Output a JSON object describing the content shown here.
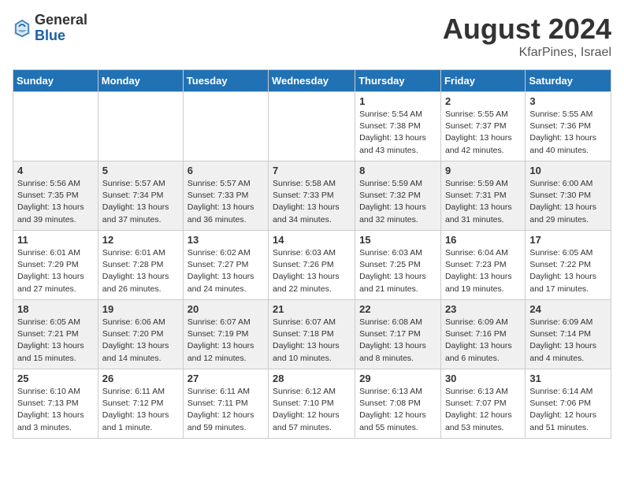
{
  "logo": {
    "general": "General",
    "blue": "Blue"
  },
  "header": {
    "month_year": "August 2024",
    "location": "KfarPines, Israel"
  },
  "days_of_week": [
    "Sunday",
    "Monday",
    "Tuesday",
    "Wednesday",
    "Thursday",
    "Friday",
    "Saturday"
  ],
  "weeks": [
    [
      {
        "day": "",
        "detail": ""
      },
      {
        "day": "",
        "detail": ""
      },
      {
        "day": "",
        "detail": ""
      },
      {
        "day": "",
        "detail": ""
      },
      {
        "day": "1",
        "detail": "Sunrise: 5:54 AM\nSunset: 7:38 PM\nDaylight: 13 hours\nand 43 minutes."
      },
      {
        "day": "2",
        "detail": "Sunrise: 5:55 AM\nSunset: 7:37 PM\nDaylight: 13 hours\nand 42 minutes."
      },
      {
        "day": "3",
        "detail": "Sunrise: 5:55 AM\nSunset: 7:36 PM\nDaylight: 13 hours\nand 40 minutes."
      }
    ],
    [
      {
        "day": "4",
        "detail": "Sunrise: 5:56 AM\nSunset: 7:35 PM\nDaylight: 13 hours\nand 39 minutes."
      },
      {
        "day": "5",
        "detail": "Sunrise: 5:57 AM\nSunset: 7:34 PM\nDaylight: 13 hours\nand 37 minutes."
      },
      {
        "day": "6",
        "detail": "Sunrise: 5:57 AM\nSunset: 7:33 PM\nDaylight: 13 hours\nand 36 minutes."
      },
      {
        "day": "7",
        "detail": "Sunrise: 5:58 AM\nSunset: 7:33 PM\nDaylight: 13 hours\nand 34 minutes."
      },
      {
        "day": "8",
        "detail": "Sunrise: 5:59 AM\nSunset: 7:32 PM\nDaylight: 13 hours\nand 32 minutes."
      },
      {
        "day": "9",
        "detail": "Sunrise: 5:59 AM\nSunset: 7:31 PM\nDaylight: 13 hours\nand 31 minutes."
      },
      {
        "day": "10",
        "detail": "Sunrise: 6:00 AM\nSunset: 7:30 PM\nDaylight: 13 hours\nand 29 minutes."
      }
    ],
    [
      {
        "day": "11",
        "detail": "Sunrise: 6:01 AM\nSunset: 7:29 PM\nDaylight: 13 hours\nand 27 minutes."
      },
      {
        "day": "12",
        "detail": "Sunrise: 6:01 AM\nSunset: 7:28 PM\nDaylight: 13 hours\nand 26 minutes."
      },
      {
        "day": "13",
        "detail": "Sunrise: 6:02 AM\nSunset: 7:27 PM\nDaylight: 13 hours\nand 24 minutes."
      },
      {
        "day": "14",
        "detail": "Sunrise: 6:03 AM\nSunset: 7:26 PM\nDaylight: 13 hours\nand 22 minutes."
      },
      {
        "day": "15",
        "detail": "Sunrise: 6:03 AM\nSunset: 7:25 PM\nDaylight: 13 hours\nand 21 minutes."
      },
      {
        "day": "16",
        "detail": "Sunrise: 6:04 AM\nSunset: 7:23 PM\nDaylight: 13 hours\nand 19 minutes."
      },
      {
        "day": "17",
        "detail": "Sunrise: 6:05 AM\nSunset: 7:22 PM\nDaylight: 13 hours\nand 17 minutes."
      }
    ],
    [
      {
        "day": "18",
        "detail": "Sunrise: 6:05 AM\nSunset: 7:21 PM\nDaylight: 13 hours\nand 15 minutes."
      },
      {
        "day": "19",
        "detail": "Sunrise: 6:06 AM\nSunset: 7:20 PM\nDaylight: 13 hours\nand 14 minutes."
      },
      {
        "day": "20",
        "detail": "Sunrise: 6:07 AM\nSunset: 7:19 PM\nDaylight: 13 hours\nand 12 minutes."
      },
      {
        "day": "21",
        "detail": "Sunrise: 6:07 AM\nSunset: 7:18 PM\nDaylight: 13 hours\nand 10 minutes."
      },
      {
        "day": "22",
        "detail": "Sunrise: 6:08 AM\nSunset: 7:17 PM\nDaylight: 13 hours\nand 8 minutes."
      },
      {
        "day": "23",
        "detail": "Sunrise: 6:09 AM\nSunset: 7:16 PM\nDaylight: 13 hours\nand 6 minutes."
      },
      {
        "day": "24",
        "detail": "Sunrise: 6:09 AM\nSunset: 7:14 PM\nDaylight: 13 hours\nand 4 minutes."
      }
    ],
    [
      {
        "day": "25",
        "detail": "Sunrise: 6:10 AM\nSunset: 7:13 PM\nDaylight: 13 hours\nand 3 minutes."
      },
      {
        "day": "26",
        "detail": "Sunrise: 6:11 AM\nSunset: 7:12 PM\nDaylight: 13 hours\nand 1 minute."
      },
      {
        "day": "27",
        "detail": "Sunrise: 6:11 AM\nSunset: 7:11 PM\nDaylight: 12 hours\nand 59 minutes."
      },
      {
        "day": "28",
        "detail": "Sunrise: 6:12 AM\nSunset: 7:10 PM\nDaylight: 12 hours\nand 57 minutes."
      },
      {
        "day": "29",
        "detail": "Sunrise: 6:13 AM\nSunset: 7:08 PM\nDaylight: 12 hours\nand 55 minutes."
      },
      {
        "day": "30",
        "detail": "Sunrise: 6:13 AM\nSunset: 7:07 PM\nDaylight: 12 hours\nand 53 minutes."
      },
      {
        "day": "31",
        "detail": "Sunrise: 6:14 AM\nSunset: 7:06 PM\nDaylight: 12 hours\nand 51 minutes."
      }
    ]
  ]
}
